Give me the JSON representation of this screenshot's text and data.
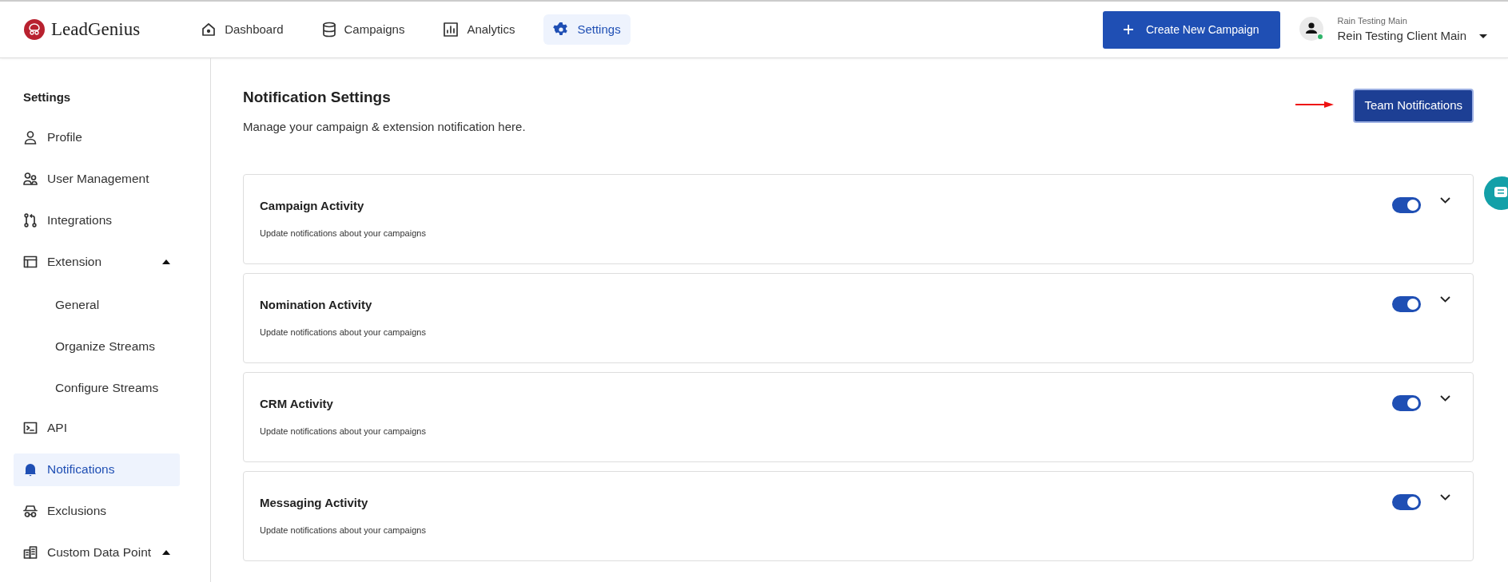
{
  "logo": {
    "text": "LeadGenius"
  },
  "nav": [
    {
      "label": "Dashboard",
      "selected": false
    },
    {
      "label": "Campaigns",
      "selected": false
    },
    {
      "label": "Analytics",
      "selected": false
    },
    {
      "label": "Settings",
      "selected": true
    }
  ],
  "create_button": "Create New Campaign",
  "account": {
    "caption": "Rain Testing Main",
    "name": "Rein Testing Client Main",
    "online": true
  },
  "sidebar": {
    "title": "Settings",
    "items": [
      {
        "label": "Profile",
        "selected": false
      },
      {
        "label": "User Management",
        "selected": false
      },
      {
        "label": "Integrations",
        "selected": false
      },
      {
        "label": "Extension",
        "selected": false,
        "expanded": true,
        "children": [
          {
            "label": "General"
          },
          {
            "label": "Organize Streams"
          },
          {
            "label": "Configure Streams"
          }
        ]
      },
      {
        "label": "API",
        "selected": false
      },
      {
        "label": "Notifications",
        "selected": true
      },
      {
        "label": "Exclusions",
        "selected": false
      },
      {
        "label": "Custom Data Point",
        "selected": false,
        "expanded": true
      }
    ]
  },
  "page": {
    "title": "Notification Settings",
    "subtitle": "Manage your campaign & extension notification here.",
    "team_button": "Team Notifications"
  },
  "sections": [
    {
      "title": "Campaign Activity",
      "description": "Update notifications about your campaigns",
      "on": true
    },
    {
      "title": "Nomination Activity",
      "description": "Update notifications about your campaigns",
      "on": true
    },
    {
      "title": "CRM Activity",
      "description": "Update notifications about your campaigns",
      "on": true
    },
    {
      "title": "Messaging Activity",
      "description": "Update notifications about your campaigns",
      "on": true
    }
  ]
}
